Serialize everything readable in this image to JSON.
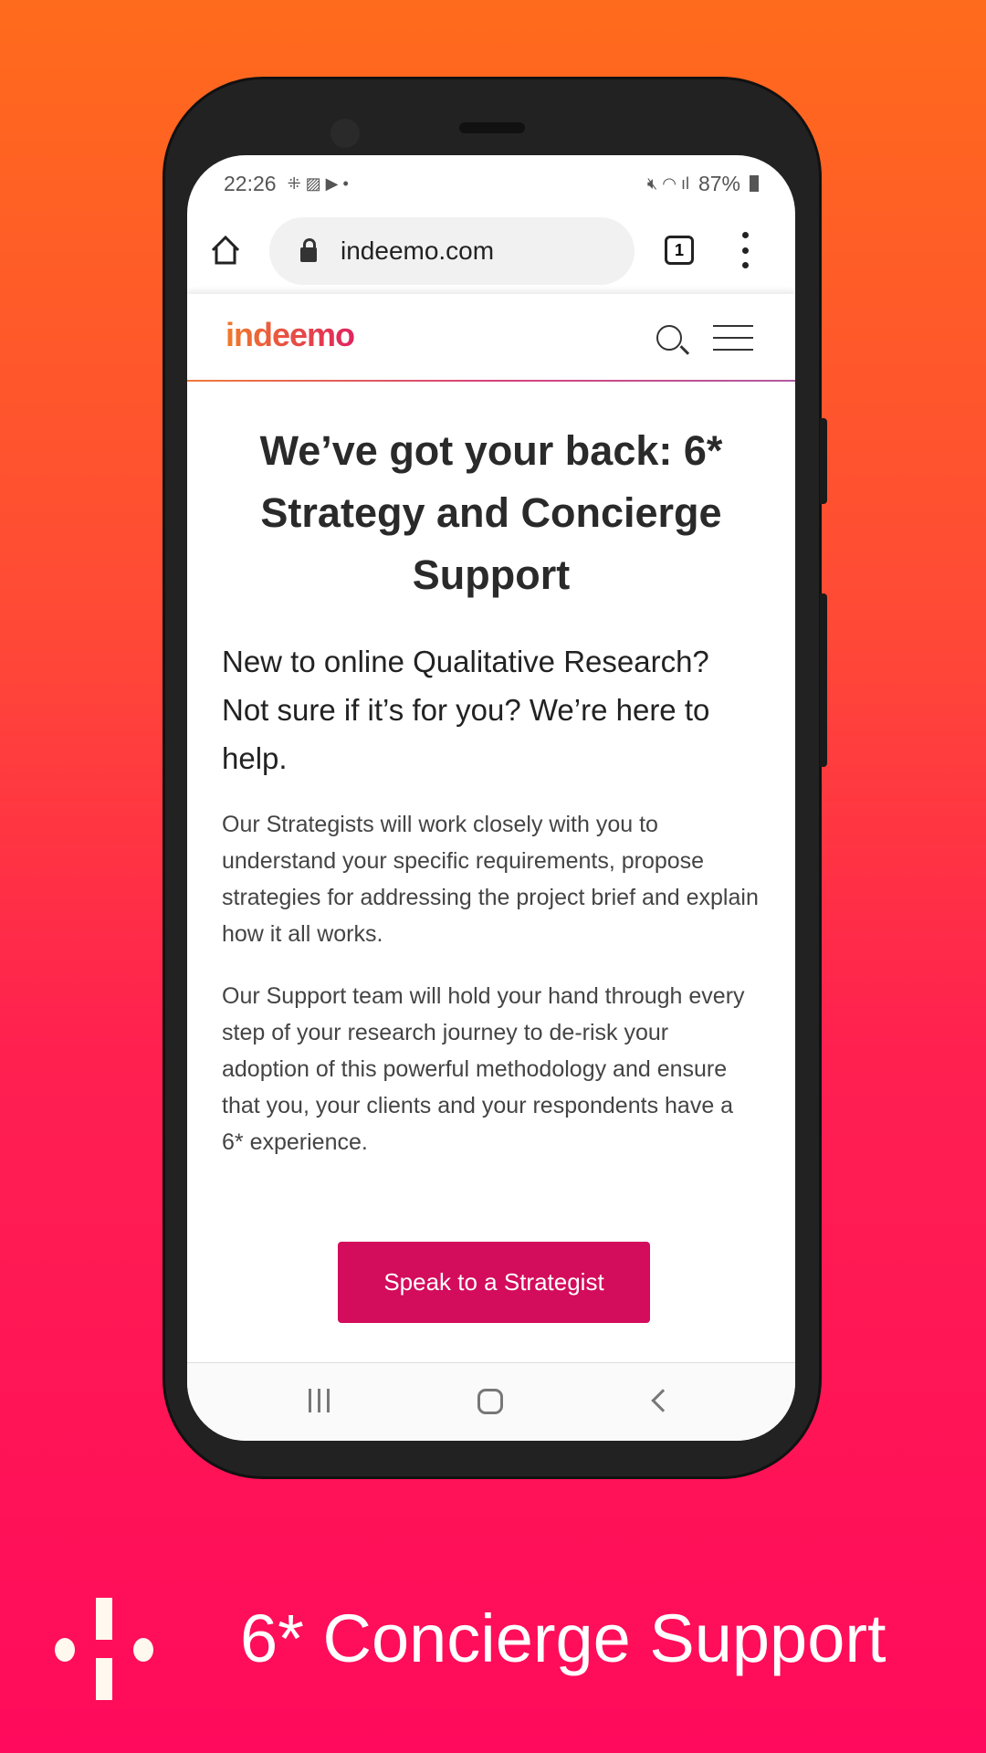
{
  "status_bar": {
    "time": "22:26",
    "battery": "87%"
  },
  "browser": {
    "url": "indeemo.com",
    "tab_count": "1"
  },
  "site": {
    "logo": "indeemo"
  },
  "content": {
    "title": "We’ve got your back: 6* Strategy and Concierge Support",
    "subtitle": "New to online Qualitative Research? Not sure if it’s for you? We’re here to help.",
    "paragraph1": "Our Strategists will work closely with you to understand your specific requirements, propose strategies for addressing the project brief and explain how it all works.",
    "paragraph2": "Our Support team will hold your hand through every step of your research journey to de-risk your adoption of this powerful methodology and ensure that you, your clients and your respondents have a 6* experience.",
    "cta_label": "Speak to a Strategist"
  },
  "tagline": "6* Concierge Support",
  "colors": {
    "accent": "#d30c5c",
    "bg_top": "#ff6b1c",
    "bg_bottom": "#ff0a5c"
  }
}
